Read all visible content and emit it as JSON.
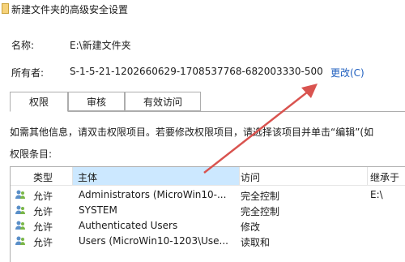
{
  "window": {
    "title": "新建文件夹的高级安全设置"
  },
  "fields": {
    "name_label": "名称:",
    "name_value": "E:\\新建文件夹",
    "owner_label": "所有者:",
    "owner_value": "S-1-5-21-1202660629-1708537768-682003330-500",
    "change_label": "更改(C)"
  },
  "tabs": [
    {
      "label": "权限"
    },
    {
      "label": "审核"
    },
    {
      "label": "有效访问"
    }
  ],
  "info_text": "如需其他信息，请双击权限项目。若要修改权限项目，请选择该项目并单击“编辑”(如",
  "entries_label": "权限条目:",
  "table": {
    "headers": [
      "类型",
      "主体",
      "访问",
      "继承于"
    ],
    "rows": [
      {
        "type": "允许",
        "principal": "Administrators (MicroWin10-...",
        "access": "完全控制",
        "inherited": "E:\\"
      },
      {
        "type": "允许",
        "principal": "SYSTEM",
        "access": "完全控制",
        "inherited": ""
      },
      {
        "type": "允许",
        "principal": "Authenticated Users",
        "access": "修改",
        "inherited": ""
      },
      {
        "type": "允许",
        "principal": "Users (MicroWin10-1203\\Use...",
        "access": "读取和",
        "inherited": ""
      }
    ]
  },
  "colors": {
    "accent_link": "#1f5fbf",
    "arrow": "#d9534f",
    "selected_header": "#cce8ff"
  }
}
